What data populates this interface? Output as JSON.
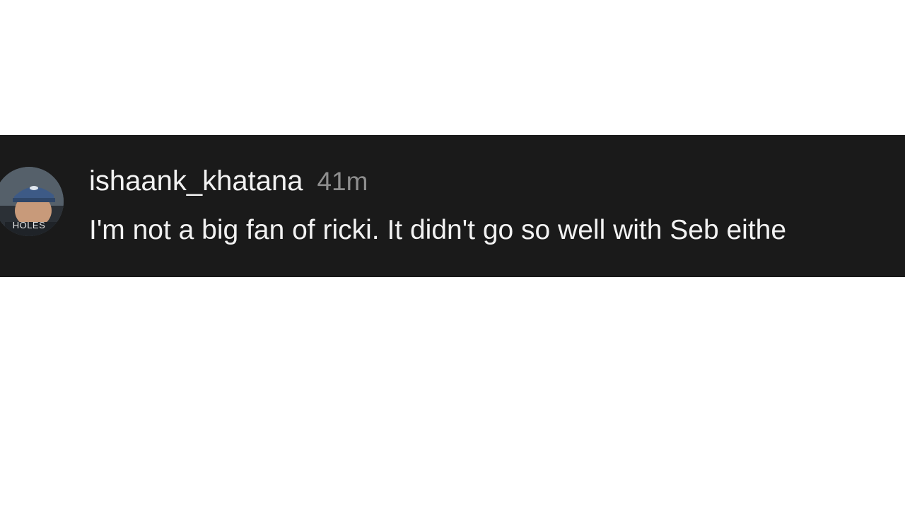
{
  "comment": {
    "avatar": {
      "icon": "user-avatar",
      "caption": "HOLES"
    },
    "username": "ishaank_khatana",
    "timestamp": "41m",
    "text": "I'm not a big fan of ricki. It didn't go so well with Seb eithe"
  },
  "colors": {
    "page_background": "#ffffff",
    "strip_background": "#1a1a1a",
    "username_color": "#f2f2f2",
    "timestamp_color": "#8e8e8e"
  }
}
